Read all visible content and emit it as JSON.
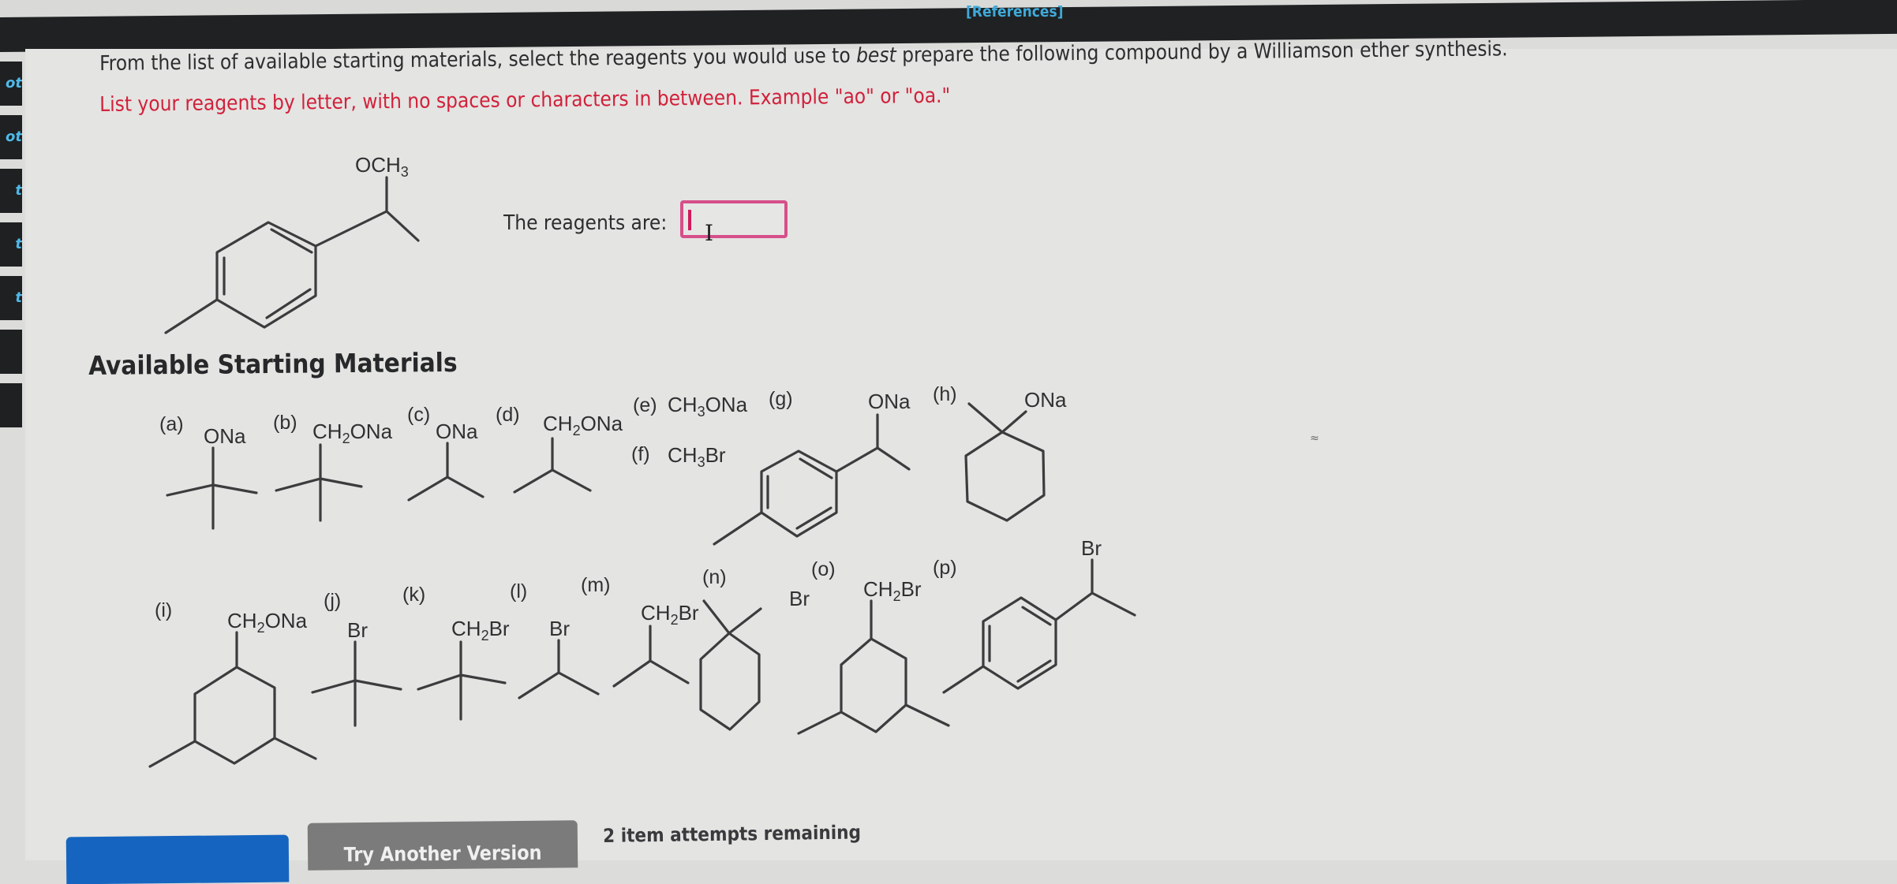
{
  "header": {
    "references_link": "[References]"
  },
  "left_tabs": [
    "ot",
    "ot",
    "t",
    "t",
    "t",
    "",
    ""
  ],
  "question": {
    "prompt_before": "From the list of available starting materials, select the reagents you would use to ",
    "prompt_emphasis": "best",
    "prompt_after": " prepare the following compound by a Williamson ether synthesis.",
    "instruction": "List your reagents by letter, with no spaces or characters in between. Example \"ao\" or \"oa.\"",
    "target_compound": {
      "label": "OCH3",
      "description": "1-(1-methoxyethyl)-4-methylbenzene"
    },
    "answer_label": "The reagents are:",
    "answer_value": "",
    "answer_border_color": "#d64f8a"
  },
  "starting_materials": {
    "title": "Available Starting Materials",
    "items": [
      {
        "letter": "(a)",
        "group": "ONa",
        "skeleton": "tert-butoxide"
      },
      {
        "letter": "(b)",
        "group": "CH2ONa",
        "skeleton": "neopentyl"
      },
      {
        "letter": "(c)",
        "group": "ONa",
        "skeleton": "isopropoxide"
      },
      {
        "letter": "(d)",
        "group": "CH2ONa",
        "skeleton": "isobutyl"
      },
      {
        "letter": "(e)",
        "group": "CH3ONa",
        "skeleton": "methoxide"
      },
      {
        "letter": "(f)",
        "group": "CH3Br",
        "skeleton": "methyl bromide"
      },
      {
        "letter": "(g)",
        "group": "ONa",
        "skeleton": "1-(p-tolyl)ethoxide"
      },
      {
        "letter": "(h)",
        "group": "ONa",
        "skeleton": "1-methylcyclohexoxide"
      },
      {
        "letter": "(i)",
        "group": "CH2ONa",
        "skeleton": "3,5-dimethylcyclohexylmethoxide"
      },
      {
        "letter": "(j)",
        "group": "Br",
        "skeleton": "tert-butyl bromide"
      },
      {
        "letter": "(k)",
        "group": "CH2Br",
        "skeleton": "neopentyl bromide"
      },
      {
        "letter": "(l)",
        "group": "Br",
        "skeleton": "isopropyl bromide"
      },
      {
        "letter": "(m)",
        "group": "CH2Br",
        "skeleton": "isobutyl bromide"
      },
      {
        "letter": "(n)",
        "group": "Br",
        "skeleton": "1-bromo-1-methylcyclohexane"
      },
      {
        "letter": "(o)",
        "group": "CH2Br",
        "skeleton": "3,5-dimethylcyclohexylmethyl bromide"
      },
      {
        "letter": "(p)",
        "group": "Br",
        "skeleton": "1-(p-tolyl)ethyl bromide"
      }
    ]
  },
  "footer": {
    "submit_label": "",
    "try_another_label": "Try Another Version",
    "attempts_text": "2 item attempts remaining"
  },
  "colors": {
    "instruction_red": "#d1213b",
    "references_blue": "#3fa9d9",
    "submit_blue": "#1565c0",
    "version_gray": "#7b7b7b"
  }
}
